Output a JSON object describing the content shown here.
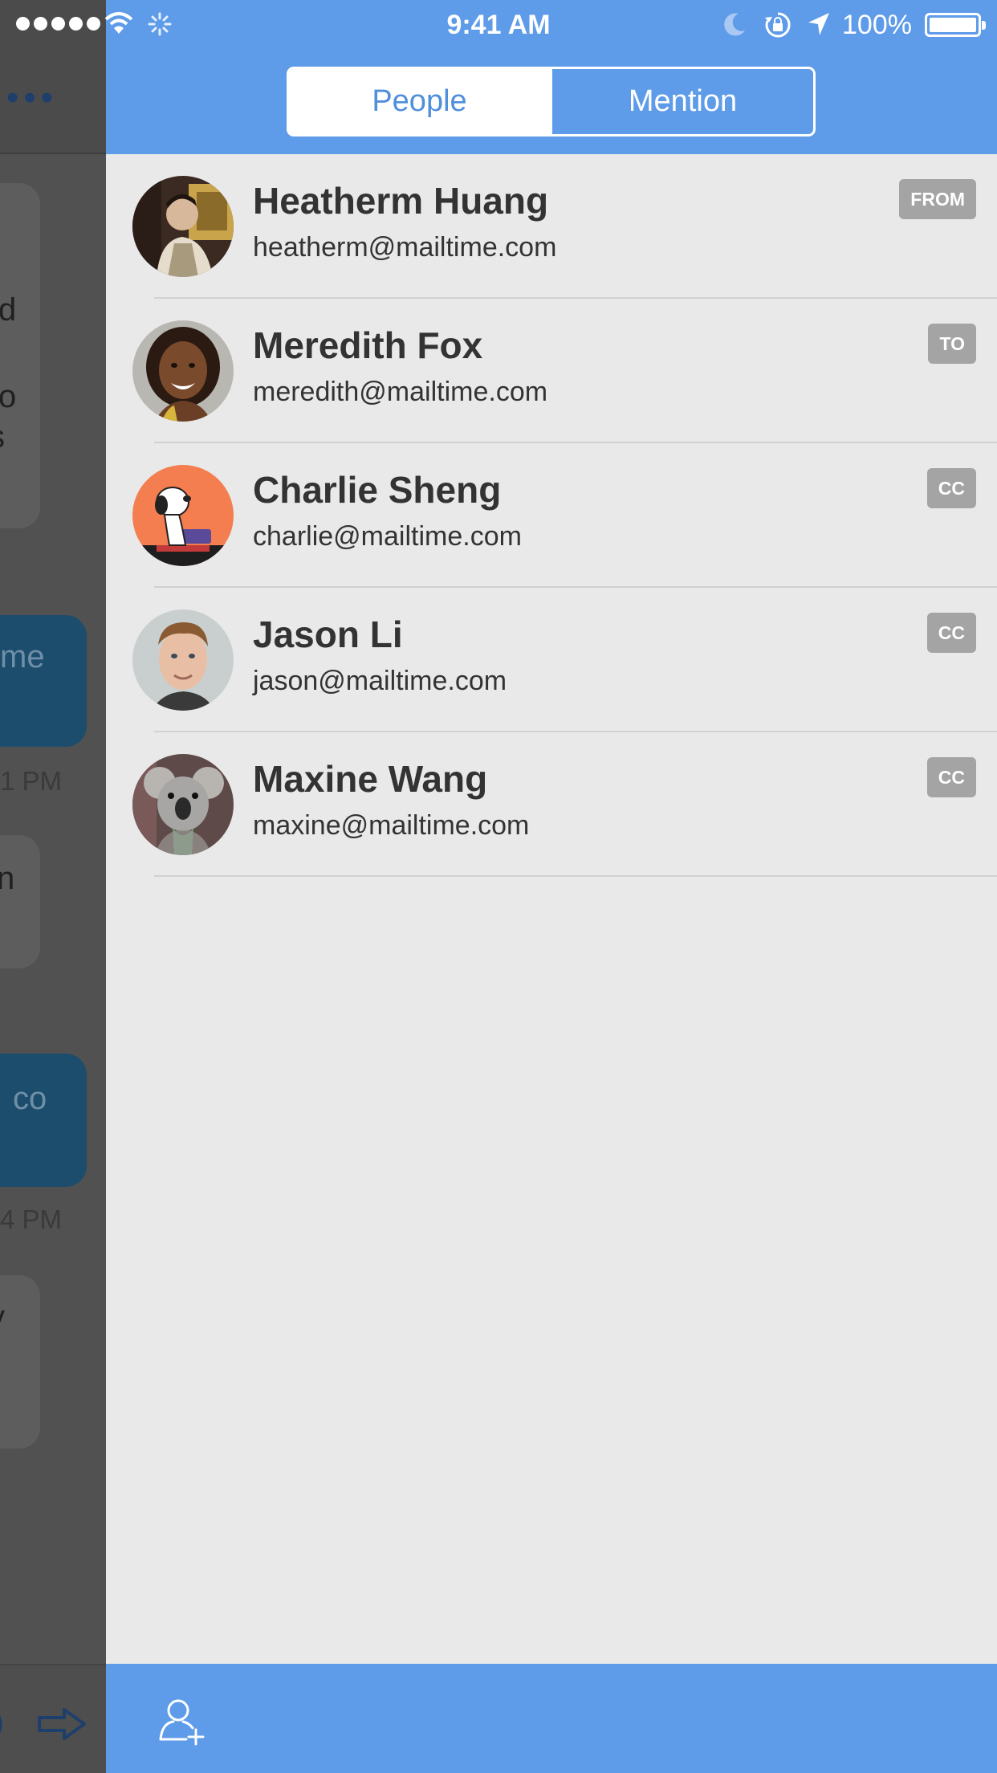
{
  "status_bar": {
    "time": "9:41 AM",
    "battery_text": "100%",
    "signal_bars": 5,
    "icons": [
      "signal-dots-icon",
      "wifi-icon",
      "activity-spinner-icon",
      "moon-icon",
      "rotation-lock-icon",
      "location-arrow-icon",
      "battery-icon"
    ]
  },
  "background": {
    "fragments": [
      "d",
      "o",
      "s",
      "me",
      "1 PM",
      "n",
      "co",
      "4 PM",
      "y"
    ],
    "icons": [
      "more-dots-icon",
      "reply-icon",
      "forward-arrow-icon"
    ]
  },
  "header": {
    "tabs": [
      {
        "label": "People",
        "active": true
      },
      {
        "label": "Mention",
        "active": false
      }
    ],
    "accent_color": "#5e9be8"
  },
  "contacts": [
    {
      "name": "Heatherm Huang",
      "email": "heatherm@mailtime.com",
      "role": "FROM",
      "avatar": "man-profile-photo"
    },
    {
      "name": "Meredith Fox",
      "email": "meredith@mailtime.com",
      "role": "TO",
      "avatar": "smiling-woman-photo"
    },
    {
      "name": "Charlie Sheng",
      "email": "charlie@mailtime.com",
      "role": "CC",
      "avatar": "snoopy-typewriter-icon"
    },
    {
      "name": "Jason Li",
      "email": "jason@mailtime.com",
      "role": "CC",
      "avatar": "young-man-photo"
    },
    {
      "name": "Maxine Wang",
      "email": "maxine@mailtime.com",
      "role": "CC",
      "avatar": "koala-photo"
    }
  ],
  "footer": {
    "icon": "add-contact-icon"
  },
  "colors": {
    "badge": "#a4a4a4",
    "list_background": "#e9e9e9",
    "text": "#333333"
  }
}
